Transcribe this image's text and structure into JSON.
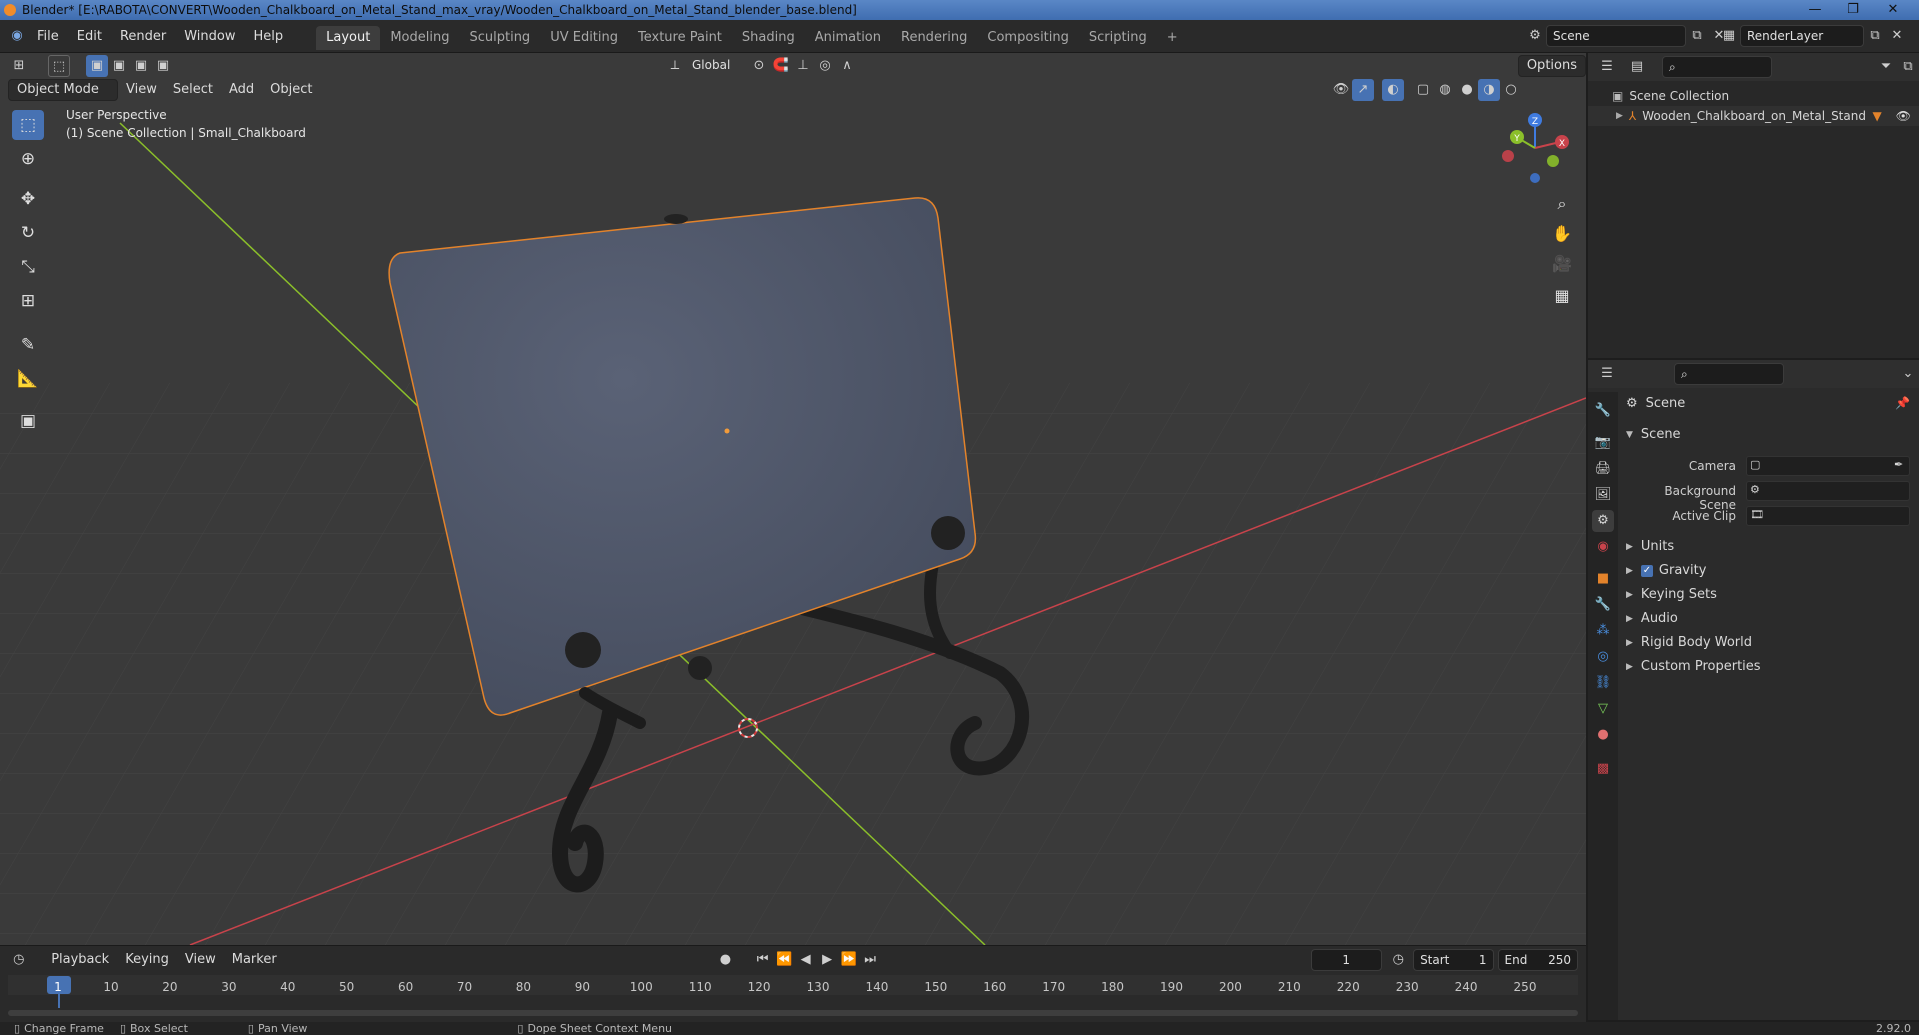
{
  "window": {
    "title": "Blender* [E:\\RABOTA\\CONVERT\\Wooden_Chalkboard_on_Metal_Stand_max_vray/Wooden_Chalkboard_on_Metal_Stand_blender_base.blend]"
  },
  "menu": {
    "items": [
      "File",
      "Edit",
      "Render",
      "Window",
      "Help"
    ]
  },
  "workspaces": {
    "tabs": [
      "Layout",
      "Modeling",
      "Sculpting",
      "UV Editing",
      "Texture Paint",
      "Shading",
      "Animation",
      "Rendering",
      "Compositing",
      "Scripting"
    ],
    "active": "Layout",
    "add_label": "+"
  },
  "scene_selector": {
    "value": "Scene"
  },
  "renderlayer_selector": {
    "value": "RenderLayer"
  },
  "tool_header": {
    "transform_orientation": "Global",
    "options_label": "Options"
  },
  "viewport_header": {
    "mode": "Object Mode",
    "menus": [
      "View",
      "Select",
      "Add",
      "Object"
    ]
  },
  "viewport": {
    "perspective_label": "User Perspective",
    "collection_label": "(1) Scene Collection | Small_Chalkboard",
    "gizmo": {
      "x": "X",
      "y": "Y",
      "z": "Z"
    }
  },
  "outliner": {
    "root": "Scene Collection",
    "items": [
      {
        "label": "Wooden_Chalkboard_on_Metal_Stand"
      }
    ]
  },
  "properties": {
    "context_label": "Scene",
    "panel_title": "Scene",
    "fields": [
      {
        "label": "Camera"
      },
      {
        "label": "Background Scene"
      },
      {
        "label": "Active Clip"
      }
    ],
    "subpanels": [
      {
        "label": "Units",
        "checkbox": false
      },
      {
        "label": "Gravity",
        "checkbox": true
      },
      {
        "label": "Keying Sets",
        "checkbox": false
      },
      {
        "label": "Audio",
        "checkbox": false
      },
      {
        "label": "Rigid Body World",
        "checkbox": false
      },
      {
        "label": "Custom Properties",
        "checkbox": false
      }
    ]
  },
  "timeline": {
    "menus": [
      "Playback",
      "Keying",
      "View",
      "Marker"
    ],
    "current_frame": "1",
    "start_label": "Start",
    "start_value": "1",
    "end_label": "End",
    "end_value": "250",
    "ticks": [
      "1",
      "10",
      "20",
      "30",
      "40",
      "50",
      "60",
      "70",
      "80",
      "90",
      "100",
      "110",
      "120",
      "130",
      "140",
      "150",
      "160",
      "170",
      "180",
      "190",
      "200",
      "210",
      "220",
      "230",
      "240",
      "250"
    ]
  },
  "statusbar": {
    "items": [
      "Change Frame",
      "Box Select",
      "Pan View",
      "Dope Sheet Context Menu"
    ],
    "version": "2.92.0"
  },
  "colors": {
    "accent": "#4772b3",
    "x_axis": "#c8434b",
    "y_axis": "#8bbf2a",
    "z_axis": "#3f7be0",
    "selection_outline": "#e3832b"
  }
}
